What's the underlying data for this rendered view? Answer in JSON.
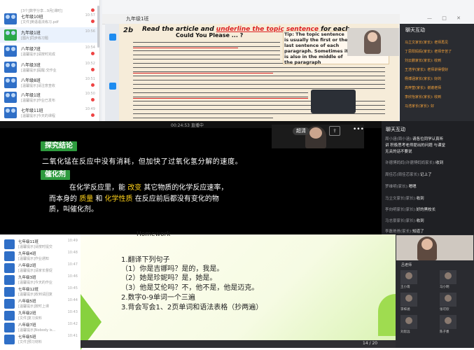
{
  "top": {
    "chat_list": [
      {
        "name": "",
        "msg": "[3个]数学分享...9月[课时]",
        "time": "",
        "badge": true
      },
      {
        "name": "七年级10班",
        "msg": "[文件]英语语法练习.pdf",
        "time": "10:57",
        "badge": true
      },
      {
        "name": "九年级1班",
        "msg": "[图片]同步练习题",
        "time": "10:56",
        "badge": false
      },
      {
        "name": "八年级7班",
        "msg": "[温馨提示]请按时完成",
        "time": "10:54",
        "badge": true
      },
      {
        "name": "八年级3班",
        "msg": "[温馨提示]提醒:交作业",
        "time": "10:52",
        "badge": true
      },
      {
        "name": "八年级8班",
        "msg": "[温馨提示]请注意查收",
        "time": "10:51",
        "badge": true
      },
      {
        "name": "八年级1班",
        "msg": "[温馨提示]作业已发布",
        "time": "10:50",
        "badge": true
      },
      {
        "name": "七年级11班",
        "msg": "[温馨提示]今天的课程",
        "time": "10:49",
        "badge": true
      }
    ],
    "window_title": "九年级1班",
    "window_buttons": "— □ ✕",
    "ppt": {
      "number": "2b",
      "heading_pre": "Read the article and ",
      "heading_underlined": "underline the topic sentence",
      "heading_post": " for each",
      "subheading": "Could You Please ... ?",
      "tip": "Tip: The topic sentence is usually the first or the last sentence of each paragraph. Sometimes it is also in the middle of the paragraph"
    },
    "chat_title": "聊天互动",
    "chat_messages": [
      {
        "text": "马立文家长(家长): 老师再见",
        "accent": true
      },
      {
        "text": "丁思阳妈妈(家长): 老师辛苦了",
        "accent": true
      },
      {
        "text": "刘云鹏家长(家长): 收到",
        "accent": true
      },
      {
        "text": "王浩宇(家长): 老师讲得很好",
        "accent": true
      },
      {
        "text": "杨博涵家长(家长): 好的",
        "accent": true
      },
      {
        "text": "高梓萱(家长): 谢谢老师",
        "accent": true
      },
      {
        "text": "李欣怡家长(家长): 收到",
        "accent": true
      },
      {
        "text": "马浩家长(家长): 好",
        "accent": true
      }
    ]
  },
  "middle": {
    "time": "00:24:53 直播中",
    "tag1": "探究结论",
    "line1": "二氧化锰在反应中没有消耗，但加快了过氧化氢分解的速度。",
    "tag2": "催化剂",
    "line2_pre": "在化学反应里，能 ",
    "line2_hl": "改变",
    "line2_post": " 其它物质的化学反应速率，",
    "line3_pre": "而本身的 ",
    "line3_hl1": "质量",
    "line3_mid": " 和 ",
    "line3_hl2": "化学性质",
    "line3_post": " 在反应前后都没有变化的物",
    "line4": "质，叫催化剂。",
    "cam_name": "超清",
    "cam_share": "⇪",
    "cam_more": "•••",
    "chat_title": "聊天互动",
    "chat_messages": [
      {
        "who": "周小涵(周小涵):",
        "text": "请各位同学认真听"
      },
      {
        "who": "",
        "text": "讲 积极思考老师提出的问题 与课堂"
      },
      {
        "who": "",
        "text": "无关的话不要说"
      },
      {
        "who": "许德博妈妈(许德博妈妈家长):",
        "text": "收到"
      },
      {
        "who": "周佳芯(周佳芯家长):",
        "text": "记上了"
      },
      {
        "who": "罗维明(家长):",
        "text": "嗯嗯"
      },
      {
        "who": "马立文家长(家长):",
        "text": "收到"
      },
      {
        "who": "李向明家长(家长):",
        "text": "好的黑校长"
      },
      {
        "who": "马志豪家长(家长):",
        "text": "收到"
      },
      {
        "who": "李磊爸爸(家长):",
        "text": "知道了"
      }
    ]
  },
  "bottom": {
    "chat_list": [
      {
        "name": "七年级11班",
        "msg": "[温馨提示]请按时提交",
        "time": "10:49"
      },
      {
        "name": "九年级4班",
        "msg": "[温馨提示]作业通知",
        "time": "10:48"
      },
      {
        "name": "八年级2班",
        "msg": "[温馨提示]请家长督促",
        "time": "10:47"
      },
      {
        "name": "九年级3班",
        "msg": "[温馨提示]今天的作业",
        "time": "10:46"
      },
      {
        "name": "七年级12班",
        "msg": "[温馨提示]收到请回复",
        "time": "10:45"
      },
      {
        "name": "八年级5班",
        "msg": "[温馨提示]按时上课",
        "time": "10:44"
      },
      {
        "name": "九年级2班",
        "msg": "[文件]复习资料",
        "time": "10:43"
      },
      {
        "name": "八年级7班",
        "msg": "[温馨提示]Nobody is...",
        "time": "10:42"
      },
      {
        "name": "七年级5班",
        "msg": "[文件]预习材料",
        "time": "10:41"
      }
    ],
    "homework_title": "Homework",
    "homework_lines": [
      "1.翻译下列句子",
      "（1）你是吉娜吗？是的，我是。",
      "（2）她是珍妮吗？是，她是。",
      "（3）他是艾伦吗？不，他不是，他是迈克。",
      "2.数字0-9单词一个三遍",
      "3.背会写会1、2页单词和语法表格（抄两遍）"
    ],
    "page": "14 / 20",
    "cam_name": "吕老师",
    "tiles": [
      "王小雨",
      "马小明",
      "李梓涵",
      "张可欣",
      "刘思远",
      "陈子墨"
    ]
  }
}
